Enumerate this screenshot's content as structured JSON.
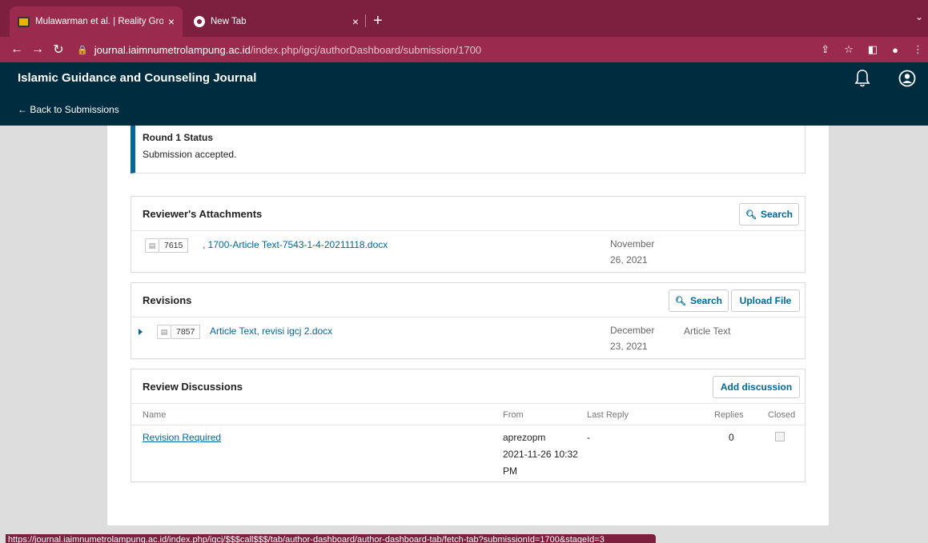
{
  "browser": {
    "tabs": [
      {
        "title": "Mulawarman et al. | Reality Gro",
        "close": "×"
      },
      {
        "title": "New Tab",
        "close": "×"
      }
    ],
    "new_tab": "+",
    "url_host": "journal.iaimnumetrolampung.ac.id",
    "url_path": "/index.php/igcj/authorDashboard/submission/1700",
    "status_url": "https://journal.iaimnumetrolampung.ac.id/index.php/igcj/$$$call$$$/tab/author-dashboard/author-dashboard-tab/fetch-tab?submissionId=1700&stageId=3"
  },
  "header": {
    "journal_title": "Islamic Guidance and Counseling Journal",
    "back_link": "← Back to Submissions"
  },
  "round_status": {
    "heading": "Round 1 Status",
    "text": "Submission accepted."
  },
  "reviewer_attachments": {
    "title": "Reviewer's Attachments",
    "search_label": "Search",
    "file": {
      "id": "7615",
      "name": ", 1700-Article Text-7543-1-4-20211118.docx",
      "date_line1": "November",
      "date_line2": "26, 2021"
    }
  },
  "revisions": {
    "title": "Revisions",
    "search_label": "Search",
    "upload_label": "Upload File",
    "file": {
      "id": "7857",
      "name": "Article Text, revisi igcj 2.docx",
      "date_line1": "December",
      "date_line2": "23, 2021",
      "genre": "Article Text"
    }
  },
  "review_discussions": {
    "title": "Review Discussions",
    "add_label": "Add discussion",
    "columns": {
      "name": "Name",
      "from": "From",
      "last_reply": "Last Reply",
      "replies": "Replies",
      "closed": "Closed"
    },
    "rows": [
      {
        "name": "Revision Required",
        "from_user": "aprezopm",
        "from_date": "2021-11-26 10:32",
        "from_time": "PM",
        "last_reply": "-",
        "replies": "0"
      }
    ]
  },
  "colors": {
    "tab_bar": "#7d1f3e",
    "address_bar": "#9b2a4f",
    "header": "#002c40",
    "accent": "#006798"
  },
  "icons": [
    "back-arrow-icon",
    "forward-arrow-icon",
    "reload-icon",
    "lock-icon",
    "share-icon",
    "star-icon",
    "sidebar-icon",
    "profile-icon",
    "bell-icon",
    "user-circle-icon",
    "search-icon",
    "file-icon"
  ]
}
